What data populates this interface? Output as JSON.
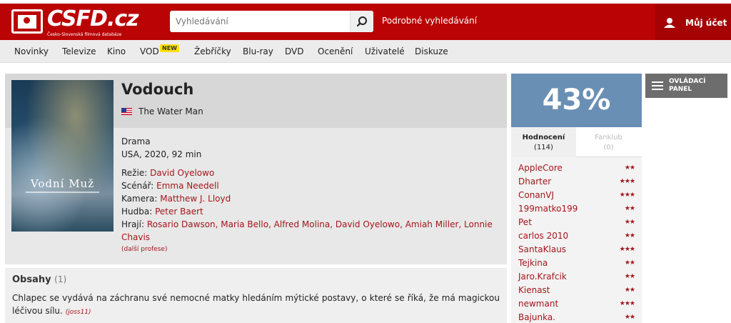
{
  "header": {
    "logo_text": "CSFD.cz",
    "logo_sub": "Česko-Slovenská filmová databáze",
    "search_placeholder": "Vyhledávání",
    "advanced_search": "Podrobné vyhledávání",
    "account": "Můj účet"
  },
  "nav": {
    "items": [
      "Novinky",
      "Televize",
      "Kino",
      "VOD",
      "Žebříčky",
      "Blu-ray",
      "DVD",
      "Ocenění",
      "Uživatelé",
      "Diskuze"
    ],
    "badge": "NEW"
  },
  "movie": {
    "poster_title": "Vodní Muž",
    "title": "Vodouch",
    "original_title": "The Water Man",
    "genre": "Drama",
    "origin": "USA, 2020, 92 min",
    "director_label": "Režie:",
    "director": "David Oyelowo",
    "writer_label": "Scénář:",
    "writer": "Emma Needell",
    "camera_label": "Kamera:",
    "camera": "Matthew J. Lloyd",
    "music_label": "Hudba:",
    "music": "Peter Baert",
    "cast_label": "Hrají:",
    "cast_line1": "Rosario Dawson, Maria Bello, Alfred Molina, David Oyelowo, Amiah Miller, Lonnie",
    "cast_line2": "Chavis",
    "more_professions": "(další profese)"
  },
  "plot": {
    "heading": "Obsahy",
    "count": "(1)",
    "text": "Chlapec se vydává na záchranu své nemocné matky hledáním mýtické postavy, o které se říká, že má magickou léčivou sílu.",
    "author": "(joss11)"
  },
  "rating": {
    "percent": "43%",
    "tab_ratings": "Hodnocení",
    "tab_ratings_count": "(114)",
    "tab_fanclub": "Fanklub",
    "tab_fanclub_count": "(0)",
    "raters": [
      {
        "name": "AppleCore",
        "stars": "★★"
      },
      {
        "name": "Dharter",
        "stars": "★★★"
      },
      {
        "name": "ConanVJ",
        "stars": "★★★"
      },
      {
        "name": "199matko199",
        "stars": "★★"
      },
      {
        "name": "Pet",
        "stars": "★★"
      },
      {
        "name": "carlos 2010",
        "stars": "★★"
      },
      {
        "name": "SantaKlaus",
        "stars": "★★★"
      },
      {
        "name": "Tejkina",
        "stars": "★★"
      },
      {
        "name": "Jaro.Krafcik",
        "stars": "★★"
      },
      {
        "name": "Kienast",
        "stars": "★★"
      },
      {
        "name": "newmant",
        "stars": "★★★"
      },
      {
        "name": "Bajunka.",
        "stars": "★★"
      }
    ]
  },
  "control_panel": {
    "label_line1": "OVLÁDACÍ",
    "label_line2": "PANEL"
  },
  "colors": {
    "brand_red": "#ba0305",
    "link_red": "#a3161b",
    "rating_blue": "#6a8fb5"
  }
}
